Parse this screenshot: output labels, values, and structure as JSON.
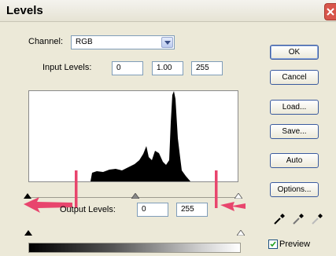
{
  "window": {
    "title": "Levels"
  },
  "channel": {
    "label": "Channel:",
    "value": "RGB"
  },
  "input_levels": {
    "label": "Input Levels:",
    "black": "0",
    "gamma": "1.00",
    "white": "255"
  },
  "output_levels": {
    "label": "Output Levels:",
    "black": "0",
    "white": "255"
  },
  "buttons": {
    "ok": "OK",
    "cancel": "Cancel",
    "load": "Load...",
    "save": "Save...",
    "auto": "Auto",
    "options": "Options..."
  },
  "preview": {
    "label": "Preview",
    "checked": true
  },
  "annotation_color": "#e8456d",
  "icons": [
    "black-eyedropper-icon",
    "gray-eyedropper-icon",
    "white-eyedropper-icon",
    "close-icon"
  ]
}
